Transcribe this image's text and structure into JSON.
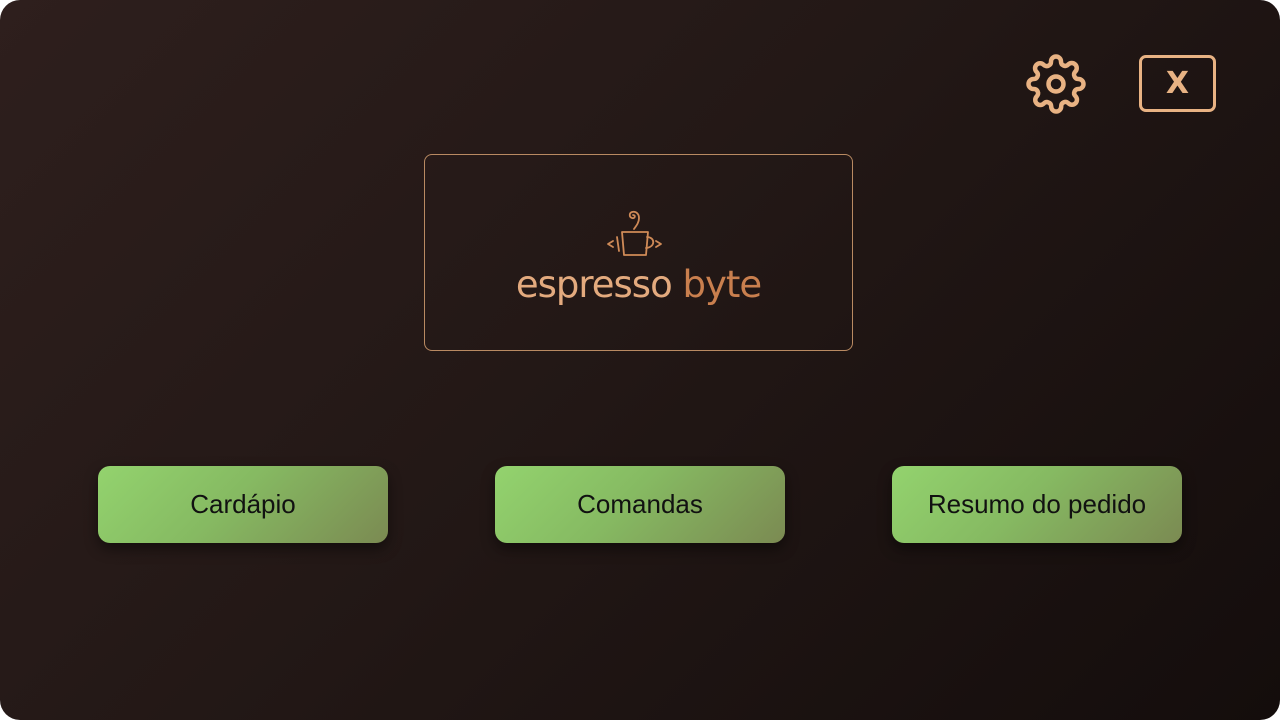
{
  "app": {
    "colors": {
      "background": "#231816",
      "accent": "#e8b283",
      "button": "#86ba62"
    }
  },
  "header": {
    "settings_icon": "gear-icon",
    "close_label": "X"
  },
  "logo": {
    "icon": "coffee-cup-code-icon",
    "word_1": "espresso",
    "word_2": "byte"
  },
  "menu": {
    "items": [
      {
        "label": "Cardápio"
      },
      {
        "label": "Comandas"
      },
      {
        "label": "Resumo do pedido"
      }
    ]
  }
}
